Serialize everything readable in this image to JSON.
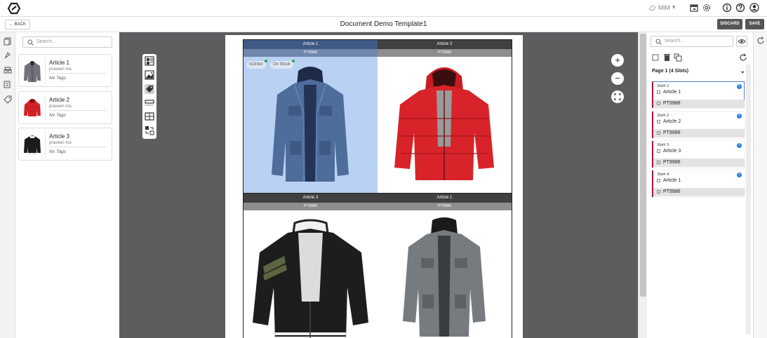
{
  "header": {
    "user": "MiM",
    "icons": [
      "calendar-icon",
      "gear-icon",
      "info-icon",
      "help-icon",
      "user-icon"
    ]
  },
  "subheader": {
    "back_label": "BACK",
    "title": "Document Demo Template1",
    "discard_label": "DISCARD",
    "save_label": "SAVE"
  },
  "left_rail": {
    "icons": [
      "documents-icon",
      "rocket-icon",
      "layers-icon",
      "list-icon",
      "tag-icon"
    ]
  },
  "article_panel": {
    "search_placeholder": "Search...",
    "articles": [
      {
        "name": "Article 1",
        "owner": "praveen ma",
        "tags": "No Tags",
        "image": "gray-jacket"
      },
      {
        "name": "Article 2",
        "owner": "praveen ma",
        "tags": "No Tags",
        "image": "red-jacket"
      },
      {
        "name": "Article 3",
        "owner": "praveen ma",
        "tags": "No Tags",
        "image": "black-jacket"
      }
    ]
  },
  "canvas": {
    "tools": [
      "grid-layout-icon",
      "image-frame-icon",
      "tag-tool-icon",
      "row-layout-icon",
      "table-layout-icon",
      "swap-icon"
    ],
    "zoom_in": "+",
    "zoom_out": "−",
    "cells": [
      {
        "article": "Article 1",
        "code": "PT9986",
        "selected": true,
        "badges": [
          "isOrder",
          "On Stock"
        ],
        "image": "blue-jacket"
      },
      {
        "article": "Article 2",
        "code": "PT9986",
        "selected": false,
        "badges": [],
        "image": "red-jacket"
      },
      {
        "article": "Article 3",
        "code": "PT9986",
        "selected": false,
        "badges": [],
        "image": "black-jacket"
      },
      {
        "article": "Article 1",
        "code": "PT9986",
        "selected": false,
        "badges": [],
        "image": "gray-jacket"
      }
    ]
  },
  "slot_panel": {
    "search_placeholder": "Search...",
    "page_header": "Page 1 (4 Slots)",
    "slots": [
      {
        "label": "Slot# 1",
        "article": "Article 1",
        "code": "PT9986",
        "active": true
      },
      {
        "label": "Slot# 2",
        "article": "Article 2",
        "code": "PT9986",
        "active": false
      },
      {
        "label": "Slot# 3",
        "article": "Article 3",
        "code": "PT9986",
        "active": false
      },
      {
        "label": "Slot# 4",
        "article": "Article 1",
        "code": "PT9986",
        "active": false
      }
    ]
  },
  "colors": {
    "selected_cell_bg": "#b9d1f3",
    "slot_accent": "#a31a3a",
    "header_dark": "#404040",
    "canvas_bg": "#5c5d5f"
  }
}
